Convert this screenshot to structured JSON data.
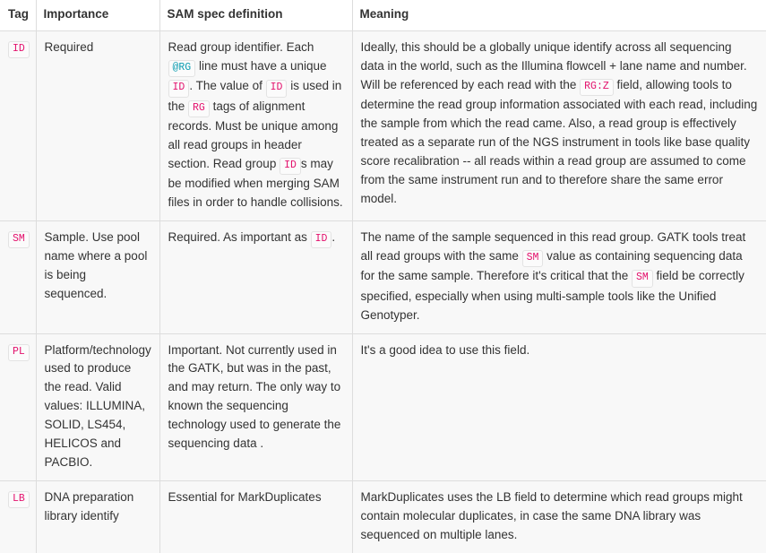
{
  "table": {
    "columns": [
      "Tag",
      "Importance",
      "SAM spec definition",
      "Meaning"
    ],
    "accent_code_color": "#e3116c",
    "accent_code_alt_color": "#0b9cb0",
    "row_background": "#f8f8f8",
    "border_color": "#dddddd",
    "rows": [
      {
        "tag": "ID",
        "importance": "Required",
        "spec_parts": [
          {
            "type": "text",
            "value": "Read group identifier. Each "
          },
          {
            "type": "code",
            "value": "@RG",
            "color": "teal"
          },
          {
            "type": "text",
            "value": " line must have a unique "
          },
          {
            "type": "code",
            "value": "ID"
          },
          {
            "type": "text",
            "value": ". The value of "
          },
          {
            "type": "code",
            "value": "ID"
          },
          {
            "type": "text",
            "value": " is used in the "
          },
          {
            "type": "code",
            "value": "RG"
          },
          {
            "type": "text",
            "value": " tags of alignment records. Must be unique among all read groups in header section. Read group "
          },
          {
            "type": "code",
            "value": "ID"
          },
          {
            "type": "text",
            "value": "s may be modified when merging SAM files in order to handle collisions."
          }
        ],
        "meaning_parts": [
          {
            "type": "text",
            "value": "Ideally, this should be a globally unique identify across all sequencing data in the world, such as the Illumina flowcell + lane name and number. Will be referenced by each read with the "
          },
          {
            "type": "code",
            "value": "RG:Z"
          },
          {
            "type": "text",
            "value": " field, allowing tools to determine the read group information associated with each read, including the sample from which the read came. Also, a read group is effectively treated as a separate run of the NGS instrument in tools like base quality score recalibration -- all reads within a read group are assumed to come from the same instrument run and to therefore share the same error model."
          }
        ]
      },
      {
        "tag": "SM",
        "importance": "Sample. Use pool name where a pool is being sequenced.",
        "spec_parts": [
          {
            "type": "text",
            "value": "Required. As important as "
          },
          {
            "type": "code",
            "value": "ID"
          },
          {
            "type": "text",
            "value": "."
          }
        ],
        "meaning_parts": [
          {
            "type": "text",
            "value": "The name of the sample sequenced in this read group. GATK tools treat all read groups with the same "
          },
          {
            "type": "code",
            "value": "SM"
          },
          {
            "type": "text",
            "value": " value as containing sequencing data for the same sample. Therefore it's critical that the "
          },
          {
            "type": "code",
            "value": "SM"
          },
          {
            "type": "text",
            "value": " field be correctly specified, especially when using multi-sample tools like the Unified Genotyper."
          }
        ]
      },
      {
        "tag": "PL",
        "importance": "Platform/technology used to produce the read. Valid values: ILLUMINA, SOLID, LS454, HELICOS and PACBIO.",
        "spec_parts": [
          {
            "type": "text",
            "value": "Important. Not currently used in the GATK, but was in the past, and may return. The only way to known the sequencing technology used to generate the sequencing data ."
          }
        ],
        "meaning_parts": [
          {
            "type": "text",
            "value": "It's a good idea to use this field."
          }
        ]
      },
      {
        "tag": "LB",
        "importance": "DNA preparation library identify",
        "spec_parts": [
          {
            "type": "text",
            "value": "Essential for MarkDuplicates"
          }
        ],
        "meaning_parts": [
          {
            "type": "text",
            "value": "MarkDuplicates uses the LB field to determine which read groups might contain molecular duplicates, in case the same DNA library was sequenced on multiple lanes."
          }
        ]
      }
    ]
  }
}
